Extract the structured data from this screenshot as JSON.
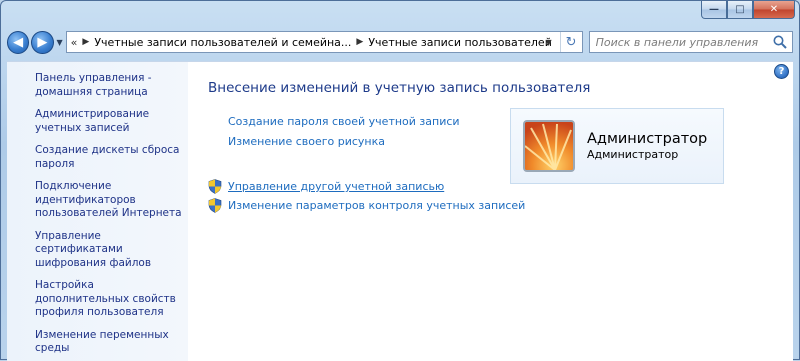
{
  "window": {
    "caption_buttons": {
      "minimize": "—",
      "maximize": "□",
      "close": "✕"
    }
  },
  "nav": {
    "back_icon": "back-arrow-icon",
    "forward_icon": "forward-arrow-icon",
    "history_icon": "chevron-down-icon"
  },
  "address": {
    "prefix": "«",
    "crumbs": [
      "Учетные записи пользователей и семейна...",
      "Учетные записи пользователей"
    ],
    "separator": "▶",
    "dropdown": "▼",
    "refresh": "↻"
  },
  "search": {
    "placeholder": "Поиск в панели управления"
  },
  "sidebar": {
    "items": [
      {
        "label": "Панель управления - домашняя страница"
      },
      {
        "label": "Администрирование учетных записей"
      },
      {
        "label": "Создание дискеты сброса пароля"
      },
      {
        "label": "Подключение идентификаторов пользователей Интернета"
      },
      {
        "label": "Управление сертификатами шифрования файлов"
      },
      {
        "label": "Настройка дополнительных свойств профиля пользователя"
      },
      {
        "label": "Изменение переменных среды"
      }
    ]
  },
  "main": {
    "help": "?",
    "title": "Внесение изменений в учетную запись пользователя",
    "tasks": [
      {
        "label": "Создание пароля своей учетной записи"
      },
      {
        "label": "Изменение своего рисунка"
      }
    ],
    "admin_tasks": [
      {
        "label": "Управление другой учетной записью",
        "icon": "uac-shield-icon"
      },
      {
        "label": "Изменение параметров контроля учетных записей",
        "icon": "uac-shield-icon"
      }
    ],
    "account": {
      "name": "Администратор",
      "role": "Администратор"
    }
  },
  "colors": {
    "link": "#1e6cbf",
    "sidebar_link": "#1e3287",
    "title": "#1e3b8a",
    "window_frame": "#aecbe8",
    "close_button": "#c0432c"
  }
}
